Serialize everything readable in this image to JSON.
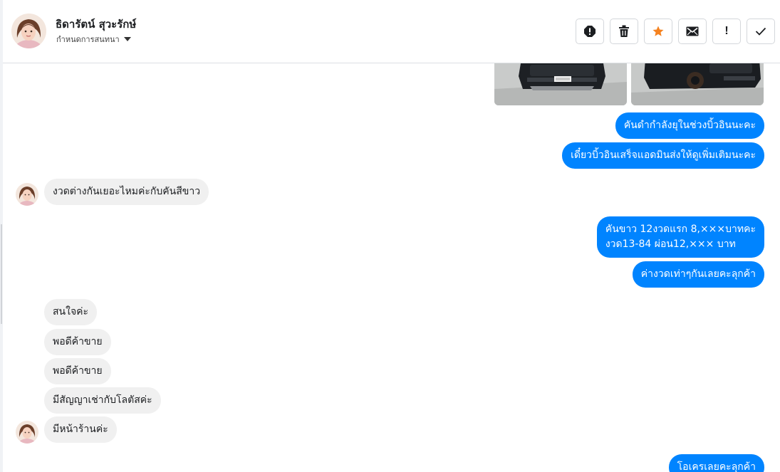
{
  "contact": {
    "name": "ธิดารัตน์ สุวะรักษ์",
    "subtitle": "กำหนดการสนทนา"
  },
  "actions": [
    {
      "name": "alert-icon",
      "label": ""
    },
    {
      "name": "trash-icon",
      "label": ""
    },
    {
      "name": "star-icon",
      "label": "",
      "color": "#f5821f"
    },
    {
      "name": "mail-icon",
      "label": ""
    },
    {
      "name": "exclamation-icon",
      "label": "!"
    },
    {
      "name": "check-icon",
      "label": ""
    }
  ],
  "messages": {
    "out1": "คันดำกำลังยุในช่วงบิ้วอินนะคะ",
    "out2": "เดี๋ยวบิ้วอินเสร็จแอดมินส่งให้ดูเพิ่มเติมนะคะ",
    "in1": "งวดต่างกันเยอะไหมค่ะกับคันสีขาว",
    "out3_line1": "คันขาว 12งวดแรก 8,×××บาทคะ",
    "out3_line2": "งวด13-84 ผ่อน12,××× บาท",
    "out4": "ค่างวดเท่าๆกันเลยคะลุกค้า",
    "in2": "สนใจค่ะ",
    "in3": "พอดีค้าขาย",
    "in4": "พอดีค้าขาย",
    "in5": "มีสัญญาเช่ากับโลตัสค่ะ",
    "in6": "มีหน้าร้านค่ะ",
    "out5": "โอเครเลยคะลุกค้า"
  },
  "colors": {
    "outgoing": "#0084ff",
    "incoming": "#f0f0f0",
    "star": "#f5821f"
  }
}
